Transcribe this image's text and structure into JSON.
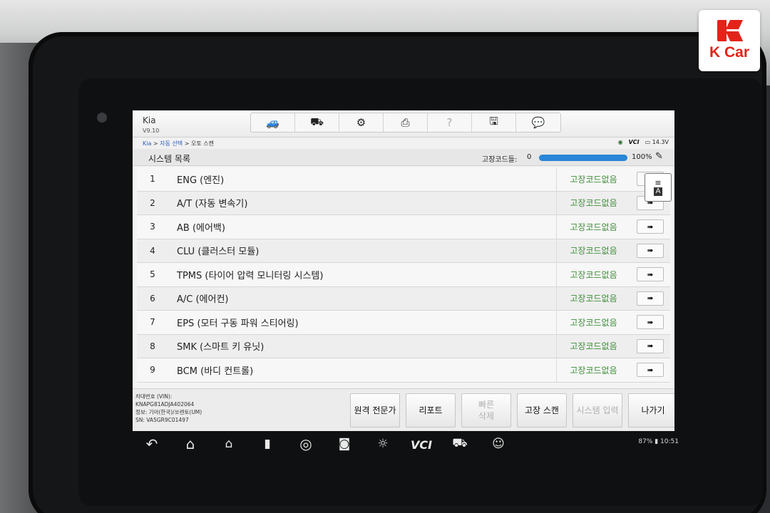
{
  "brand": {
    "name": "K Car",
    "color": "#e2231a"
  },
  "app": {
    "name": "Kia",
    "version": "V9.10"
  },
  "toolbar": [
    {
      "icon": "vehicle-swap-icon",
      "glyph": "🚙"
    },
    {
      "icon": "car-lift-icon",
      "glyph": "⛟"
    },
    {
      "icon": "gear-icon",
      "glyph": "⚙"
    },
    {
      "icon": "printer-icon",
      "glyph": "⎙"
    },
    {
      "icon": "help-icon",
      "glyph": "?"
    },
    {
      "icon": "save-icon",
      "glyph": "🖫"
    },
    {
      "icon": "message-icon",
      "glyph": "💬"
    }
  ],
  "breadcrumb": {
    "root": "Kia",
    "sep1": " > ",
    "middle": "자동 선택",
    "sep2": " > ",
    "current": "오토 스캔"
  },
  "status": {
    "vci": "VCI",
    "voltage": "14.3V"
  },
  "list": {
    "title": "시스템 목록",
    "dtc_label": "고장코드들:",
    "dtc_count": "0",
    "progress": 1.0,
    "progress_text": "100%"
  },
  "rows": [
    {
      "num": "1",
      "name": "ENG (엔진)",
      "status": "고장코드없음"
    },
    {
      "num": "2",
      "name": "A/T (자동 변속기)",
      "status": "고장코드없음"
    },
    {
      "num": "3",
      "name": "AB (에어백)",
      "status": "고장코드없음"
    },
    {
      "num": "4",
      "name": "CLU (클러스터 모듈)",
      "status": "고장코드없음"
    },
    {
      "num": "5",
      "name": "TPMS (타이어 압력 모니터링 시스템)",
      "status": "고장코드없음"
    },
    {
      "num": "6",
      "name": "A/C (에어컨)",
      "status": "고장코드없음"
    },
    {
      "num": "7",
      "name": "EPS (모터 구동 파워 스티어링)",
      "status": "고장코드없음"
    },
    {
      "num": "8",
      "name": "SMK (스마트 키 유닛)",
      "status": "고장코드없음"
    },
    {
      "num": "9",
      "name": "BCM (바디 컨트롤)",
      "status": "고장코드없음"
    }
  ],
  "row_arrow": "➠",
  "status_color": "#3f8f3a",
  "float": {
    "line1": "≡",
    "line2": "A"
  },
  "vehicle": {
    "vin_label": "차대번호 (VIN):",
    "vin": "KNAPG81ADJA402064",
    "info": "정보: 기아(한국)/쏘렌토(UM)",
    "sn": "SN: VA5GR9C01497"
  },
  "footer_buttons": [
    {
      "label": "원격 전문가",
      "enabled": true
    },
    {
      "label": "리포트",
      "enabled": true
    },
    {
      "label": "빠른\n삭제",
      "enabled": false
    },
    {
      "label": "고장 스캔",
      "enabled": true
    },
    {
      "label": "시스템 입력",
      "enabled": false
    },
    {
      "label": "나가기",
      "enabled": true
    }
  ],
  "android": {
    "status": "87% ▮ 10:51"
  }
}
